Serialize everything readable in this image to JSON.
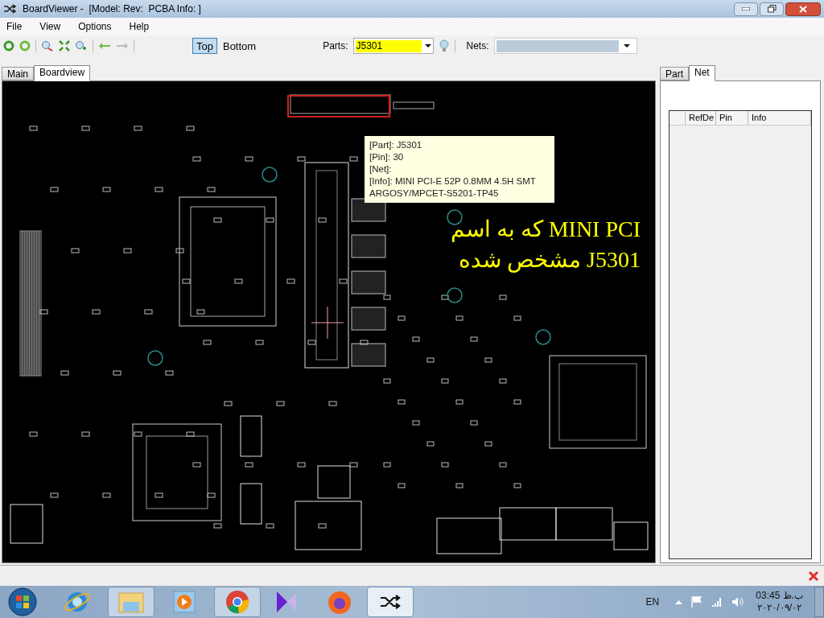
{
  "window": {
    "title": "BoardViewer -  [Model: Rev:  PCBA Info: ]"
  },
  "menu": [
    "File",
    "View",
    "Options",
    "Help"
  ],
  "view_toggle": [
    {
      "label": "Top",
      "selected": true
    },
    {
      "label": "Bottom",
      "selected": false
    }
  ],
  "parts": {
    "label": "Parts:",
    "value": "J5301"
  },
  "nets": {
    "label": "Nets:"
  },
  "left_tabs": [
    {
      "label": "Main",
      "selected": false
    },
    {
      "label": "Boardview",
      "selected": true
    }
  ],
  "tooltip": [
    "[Part]: J5301",
    "[Pin]: 30",
    "[Net]:",
    "[Info]: MINI PCI-E 52P 0.8MM 4.5H SMT",
    "ARGOSY/MPCET-S5201-TP45"
  ],
  "annotation": [
    "MINI PCI که به اسم",
    "J5301 مشخص شده"
  ],
  "right_tabs": [
    {
      "label": "Part",
      "selected": false
    },
    {
      "label": "Net",
      "selected": true
    }
  ],
  "net_table": {
    "columns": [
      "RefDe",
      "Pin",
      "Info"
    ]
  },
  "taskbar": {
    "language": "EN",
    "time": "03:45 ب.ظ",
    "date": "۲۰۲۰/۰۹/۰۲"
  }
}
